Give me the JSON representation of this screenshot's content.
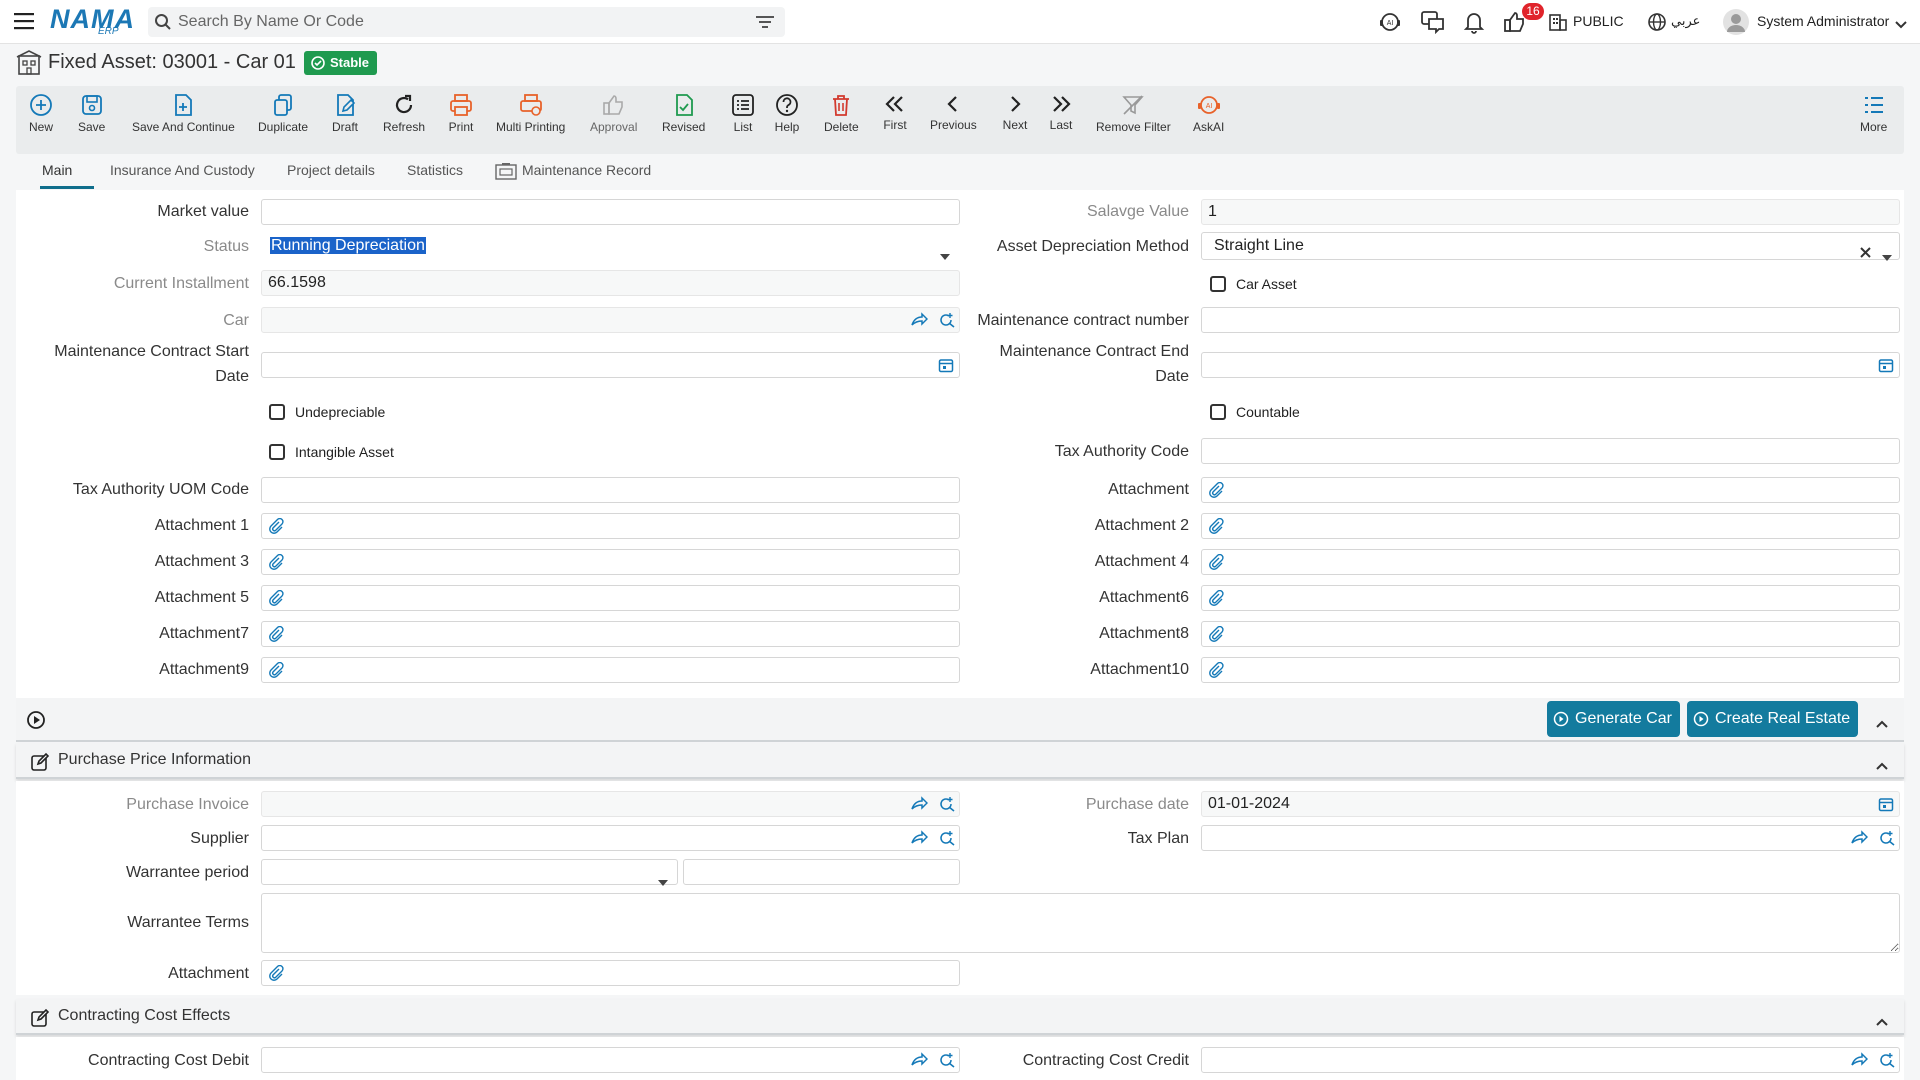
{
  "app": {
    "logo_main": "NAMA",
    "logo_sub": "ERP"
  },
  "search": {
    "placeholder": "Search By Name Or Code"
  },
  "header": {
    "notif_count": "16",
    "public_label": "PUBLIC",
    "lang_label": "عربي",
    "user_name": "System Administrator"
  },
  "page": {
    "title": "Fixed Asset: 03001 - Car 01",
    "status": "Stable"
  },
  "toolbar": {
    "new": "New",
    "save": "Save",
    "save_continue": "Save And Continue",
    "duplicate": "Duplicate",
    "draft": "Draft",
    "refresh": "Refresh",
    "print": "Print",
    "multi_printing": "Multi Printing",
    "approval": "Approval",
    "revised": "Revised",
    "list": "List",
    "help": "Help",
    "delete": "Delete",
    "first": "First",
    "previous": "Previous",
    "next": "Next",
    "last": "Last",
    "remove_filter": "Remove Filter",
    "askai": "AskAI",
    "more": "More"
  },
  "tabs": {
    "main": "Main",
    "insurance": "Insurance And Custody",
    "project": "Project details",
    "statistics": "Statistics",
    "maintenance": "Maintenance Record"
  },
  "form": {
    "market_value": {
      "label": "Market value",
      "value": ""
    },
    "salvage_value": {
      "label": "Salavge Value",
      "value": "1"
    },
    "status": {
      "label": "Status",
      "value": "Running Depreciation"
    },
    "depreciation_method": {
      "label": "Asset Depreciation Method",
      "value": "Straight Line"
    },
    "current_installment": {
      "label": "Current Installment",
      "value": "66.1598"
    },
    "car_asset": {
      "label": "Car Asset"
    },
    "car": {
      "label": "Car",
      "value": ""
    },
    "maint_contract_no": {
      "label": "Maintenance contract number",
      "value": ""
    },
    "maint_start": {
      "label_1": "Maintenance Contract Start",
      "label_2": "Date",
      "value": ""
    },
    "maint_end": {
      "label_1": "Maintenance Contract End",
      "label_2": "Date",
      "value": ""
    },
    "undepreciable": {
      "label": "Undepreciable"
    },
    "countable": {
      "label": "Countable"
    },
    "intangible": {
      "label": "Intangible Asset"
    },
    "tax_authority_code": {
      "label": "Tax Authority Code",
      "value": ""
    },
    "tax_uom_code": {
      "label": "Tax Authority UOM Code",
      "value": ""
    },
    "attachment": {
      "label": "Attachment"
    },
    "attachment1": {
      "label": "Attachment 1"
    },
    "attachment2": {
      "label": "Attachment 2"
    },
    "attachment3": {
      "label": "Attachment 3"
    },
    "attachment4": {
      "label": "Attachment 4"
    },
    "attachment5": {
      "label": "Attachment 5"
    },
    "attachment6": {
      "label": "Attachment6"
    },
    "attachment7": {
      "label": "Attachment7"
    },
    "attachment8": {
      "label": "Attachment8"
    },
    "attachment9": {
      "label": "Attachment9"
    },
    "attachment10": {
      "label": "Attachment10"
    }
  },
  "actions": {
    "generate_car": "Generate Car",
    "create_real_estate": "Create Real Estate"
  },
  "purchase": {
    "title": "Purchase Price Information",
    "invoice": {
      "label": "Purchase Invoice",
      "value": ""
    },
    "date": {
      "label": "Purchase date",
      "value": "01-01-2024"
    },
    "supplier": {
      "label": "Supplier",
      "value": ""
    },
    "tax_plan": {
      "label": "Tax Plan",
      "value": ""
    },
    "warrantee_period": {
      "label": "Warrantee period",
      "value": ""
    },
    "warrantee_terms": {
      "label": "Warrantee Terms",
      "value": ""
    },
    "attachment": {
      "label": "Attachment"
    }
  },
  "contracting": {
    "title": "Contracting Cost Effects",
    "debit": {
      "label": "Contracting Cost Debit",
      "value": ""
    },
    "credit": {
      "label": "Contracting Cost Credit",
      "value": ""
    }
  },
  "colors": {
    "accent": "#137b9e",
    "stable": "#1f9a4f",
    "notif": "#e0242b",
    "print_icon": "#e8622a",
    "selection": "#1a63c9"
  }
}
